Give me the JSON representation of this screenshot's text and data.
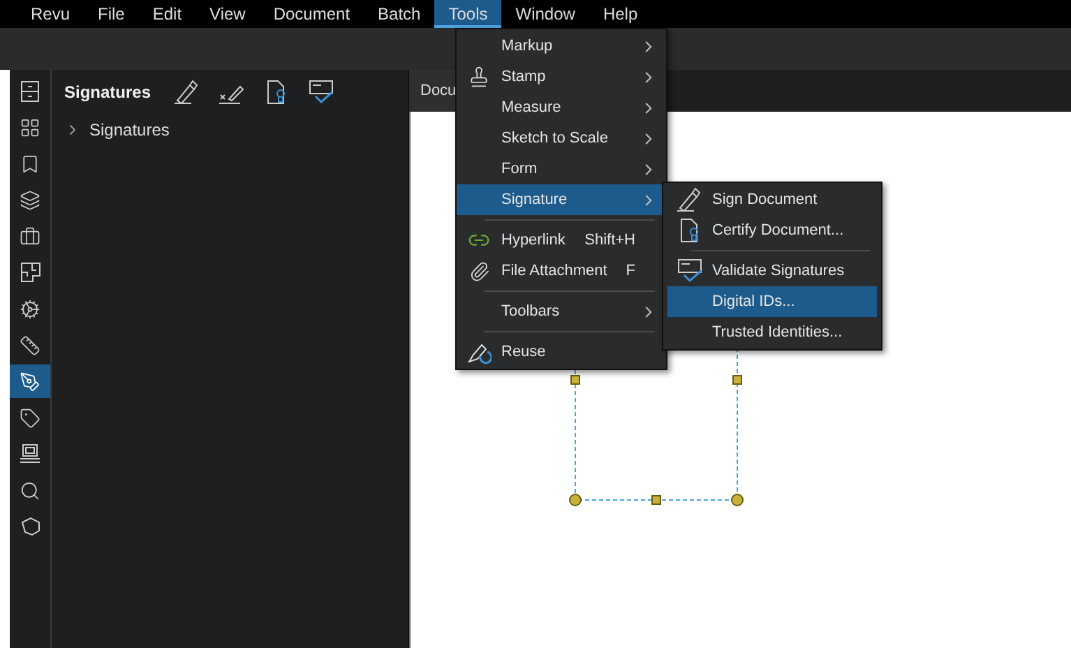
{
  "menu_bar": [
    {
      "label": "Revu",
      "selected": false
    },
    {
      "label": "File",
      "selected": false
    },
    {
      "label": "Edit",
      "selected": false
    },
    {
      "label": "View",
      "selected": false
    },
    {
      "label": "Document",
      "selected": false
    },
    {
      "label": "Batch",
      "selected": false
    },
    {
      "label": "Tools",
      "selected": true
    },
    {
      "label": "Window",
      "selected": false
    },
    {
      "label": "Help",
      "selected": false
    }
  ],
  "rail": [
    {
      "selected": false
    },
    {
      "selected": false
    },
    {
      "selected": false
    },
    {
      "selected": false
    },
    {
      "selected": false
    },
    {
      "selected": false
    },
    {
      "selected": false
    },
    {
      "selected": false
    },
    {
      "selected": true
    },
    {
      "selected": false
    },
    {
      "selected": false
    },
    {
      "selected": false
    },
    {
      "selected": false
    }
  ],
  "panel": {
    "title": "Signatures",
    "tree": [
      {
        "label": "Signatures",
        "expanded": false
      }
    ]
  },
  "document_tab": {
    "label": "Docu"
  },
  "tools_menu": [
    {
      "kind": "item",
      "label": "Markup",
      "submenu": true,
      "selected": false
    },
    {
      "kind": "item",
      "label": "Stamp",
      "submenu": true,
      "selected": false
    },
    {
      "kind": "item",
      "label": "Measure",
      "submenu": true,
      "selected": false
    },
    {
      "kind": "item",
      "label": "Sketch to Scale",
      "submenu": true,
      "selected": false
    },
    {
      "kind": "item",
      "label": "Form",
      "submenu": true,
      "selected": false
    },
    {
      "kind": "item",
      "label": "Signature",
      "submenu": true,
      "selected": true
    },
    {
      "kind": "separator"
    },
    {
      "kind": "item",
      "label": "Hyperlink",
      "shortcut": "Shift+H",
      "submenu": false,
      "selected": false
    },
    {
      "kind": "item",
      "label": "File Attachment",
      "shortcut": "F",
      "submenu": false,
      "selected": false
    },
    {
      "kind": "separator"
    },
    {
      "kind": "item",
      "label": "Toolbars",
      "submenu": true,
      "selected": false
    },
    {
      "kind": "separator"
    },
    {
      "kind": "item",
      "label": "Reuse",
      "submenu": false,
      "selected": false
    }
  ],
  "signature_submenu": [
    {
      "kind": "item",
      "label": "Sign Document",
      "selected": false
    },
    {
      "kind": "item",
      "label": "Certify Document...",
      "selected": false
    },
    {
      "kind": "separator"
    },
    {
      "kind": "item",
      "label": "Validate Signatures",
      "selected": false
    },
    {
      "kind": "item",
      "label": "Digital IDs...",
      "selected": true
    },
    {
      "kind": "item",
      "label": "Trusted Identities...",
      "selected": false
    }
  ]
}
